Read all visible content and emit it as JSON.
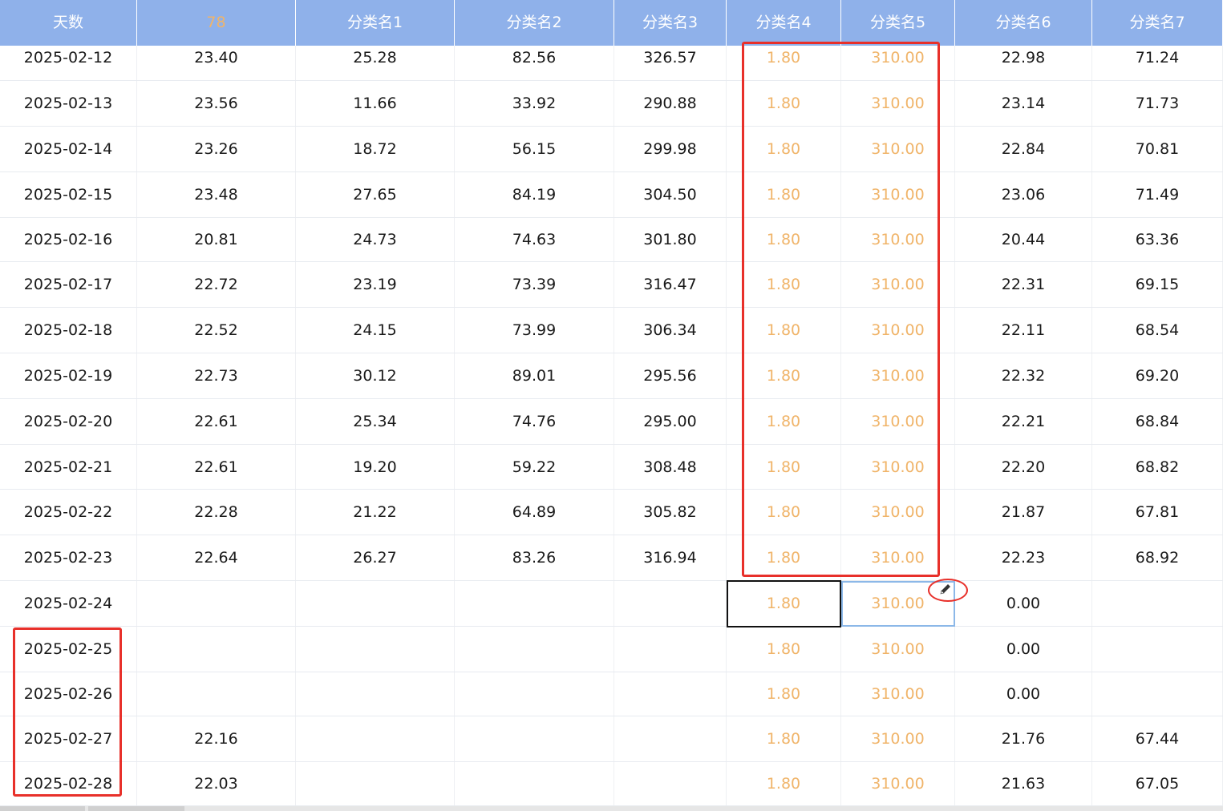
{
  "columns": [
    {
      "label": "天数",
      "accent": false
    },
    {
      "label": "78",
      "accent": true
    },
    {
      "label": "分类名1",
      "accent": false
    },
    {
      "label": "分类名2",
      "accent": false
    },
    {
      "label": "分类名3",
      "accent": false
    },
    {
      "label": "分类名4",
      "accent": false
    },
    {
      "label": "分类名5",
      "accent": false
    },
    {
      "label": "分类名6",
      "accent": false
    },
    {
      "label": "分类名7",
      "accent": false
    }
  ],
  "rows": [
    [
      "2025-02-12",
      "23.40",
      "25.28",
      "82.56",
      "326.57",
      "1.80",
      "310.00",
      "22.98",
      "71.24"
    ],
    [
      "2025-02-13",
      "23.56",
      "11.66",
      "33.92",
      "290.88",
      "1.80",
      "310.00",
      "23.14",
      "71.73"
    ],
    [
      "2025-02-14",
      "23.26",
      "18.72",
      "56.15",
      "299.98",
      "1.80",
      "310.00",
      "22.84",
      "70.81"
    ],
    [
      "2025-02-15",
      "23.48",
      "27.65",
      "84.19",
      "304.50",
      "1.80",
      "310.00",
      "23.06",
      "71.49"
    ],
    [
      "2025-02-16",
      "20.81",
      "24.73",
      "74.63",
      "301.80",
      "1.80",
      "310.00",
      "20.44",
      "63.36"
    ],
    [
      "2025-02-17",
      "22.72",
      "23.19",
      "73.39",
      "316.47",
      "1.80",
      "310.00",
      "22.31",
      "69.15"
    ],
    [
      "2025-02-18",
      "22.52",
      "24.15",
      "73.99",
      "306.34",
      "1.80",
      "310.00",
      "22.11",
      "68.54"
    ],
    [
      "2025-02-19",
      "22.73",
      "30.12",
      "89.01",
      "295.56",
      "1.80",
      "310.00",
      "22.32",
      "69.20"
    ],
    [
      "2025-02-20",
      "22.61",
      "25.34",
      "74.76",
      "295.00",
      "1.80",
      "310.00",
      "22.21",
      "68.84"
    ],
    [
      "2025-02-21",
      "22.61",
      "19.20",
      "59.22",
      "308.48",
      "1.80",
      "310.00",
      "22.20",
      "68.82"
    ],
    [
      "2025-02-22",
      "22.28",
      "21.22",
      "64.89",
      "305.82",
      "1.80",
      "310.00",
      "21.87",
      "67.81"
    ],
    [
      "2025-02-23",
      "22.64",
      "26.27",
      "83.26",
      "316.94",
      "1.80",
      "310.00",
      "22.23",
      "68.92"
    ],
    [
      "2025-02-24",
      "",
      "",
      "",
      "",
      "1.80",
      "310.00",
      "0.00",
      ""
    ],
    [
      "2025-02-25",
      "",
      "",
      "",
      "",
      "1.80",
      "310.00",
      "0.00",
      ""
    ],
    [
      "2025-02-26",
      "",
      "",
      "",
      "",
      "1.80",
      "310.00",
      "0.00",
      ""
    ],
    [
      "2025-02-27",
      "22.16",
      "",
      "",
      "",
      "1.80",
      "310.00",
      "21.76",
      "67.44"
    ],
    [
      "2025-02-28",
      "22.03",
      "",
      "",
      "",
      "1.80",
      "310.00",
      "21.63",
      "67.05"
    ]
  ],
  "orange_columns": [
    5,
    6
  ],
  "colors": {
    "header_bg": "#8fb1ea",
    "accent_text": "#f0b469",
    "highlight_red": "#e8302a",
    "selection_blue": "#8cb8e8"
  },
  "icons": {
    "fill_handle": "pencil-icon"
  }
}
